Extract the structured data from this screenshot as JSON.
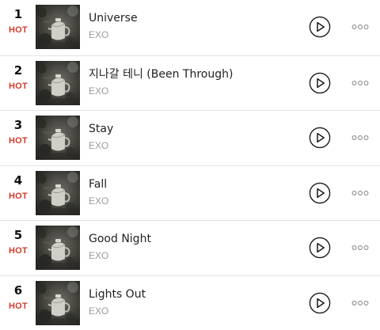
{
  "tracks": [
    {
      "rank": "1",
      "badge": "HOT",
      "title": "Universe",
      "artist": "EXO"
    },
    {
      "rank": "2",
      "badge": "HOT",
      "title": "지나갈 테니 (Been Through)",
      "artist": "EXO"
    },
    {
      "rank": "3",
      "badge": "HOT",
      "title": "Stay",
      "artist": "EXO"
    },
    {
      "rank": "4",
      "badge": "HOT",
      "title": "Fall",
      "artist": "EXO"
    },
    {
      "rank": "5",
      "badge": "HOT",
      "title": "Good Night",
      "artist": "EXO"
    },
    {
      "rank": "6",
      "badge": "HOT",
      "title": "Lights Out",
      "artist": "EXO"
    }
  ],
  "icons": {
    "play": "play-circle-icon",
    "more": "more-options-icon"
  },
  "colors": {
    "hot": "#d33a2c",
    "title": "#1f1f1f",
    "artist": "#9a9a9a",
    "separator": "#e4e4e4"
  }
}
